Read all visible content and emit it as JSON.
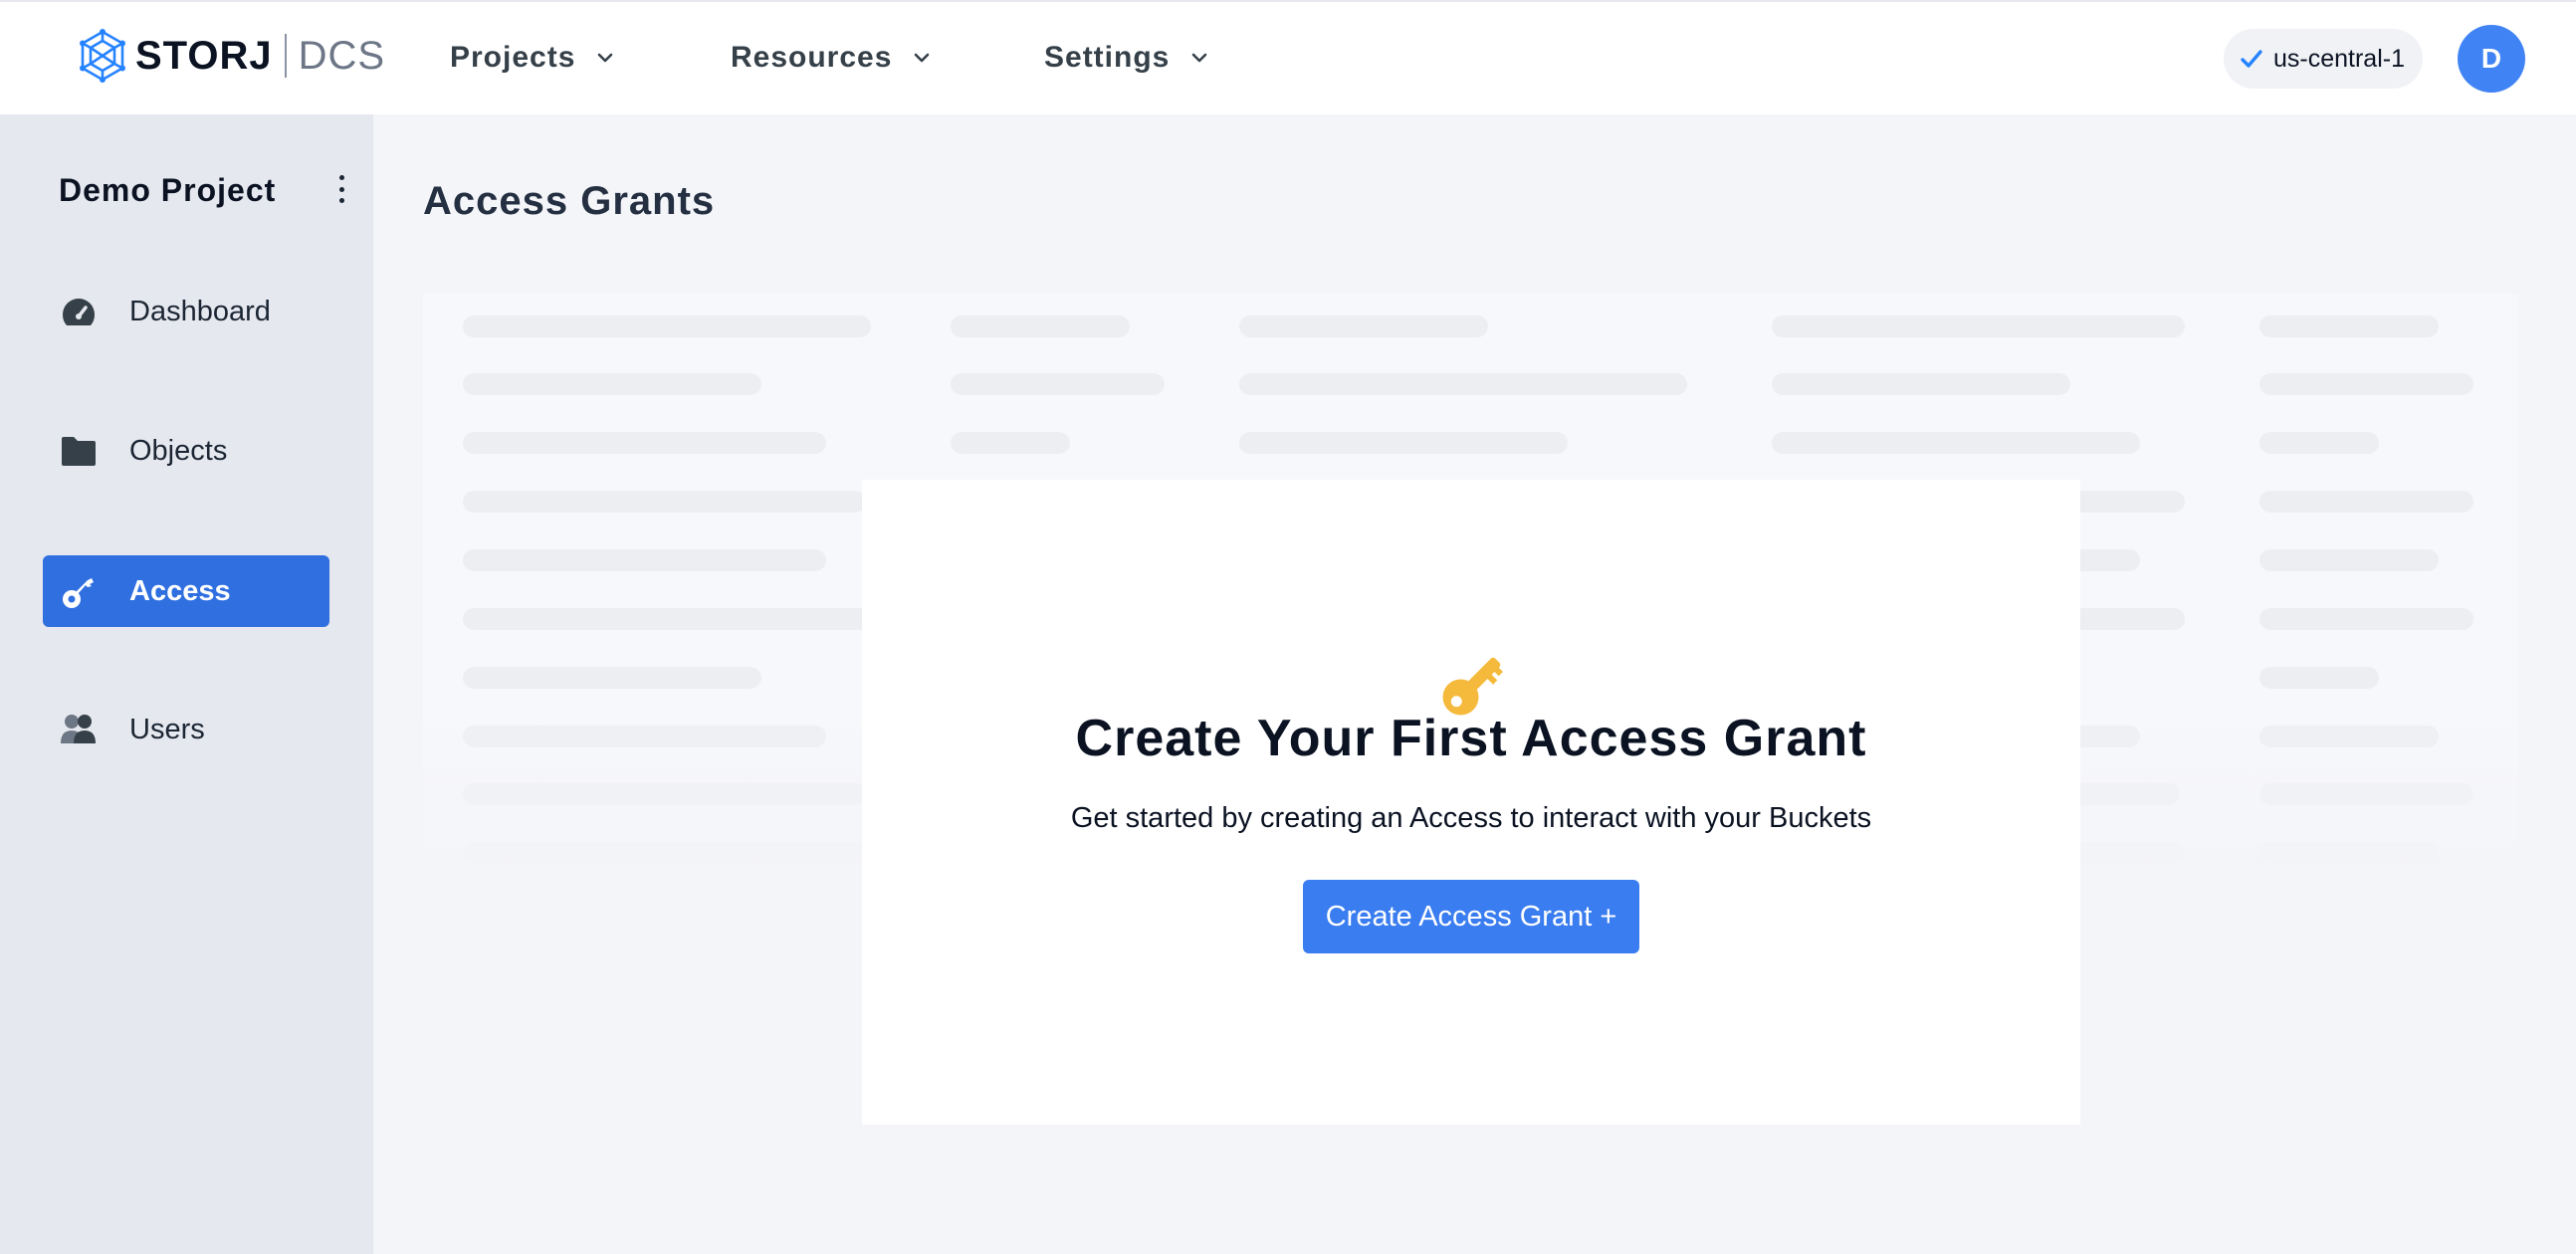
{
  "header": {
    "logo": {
      "word": "STORJ",
      "product": "DCS",
      "icon": "storj-logo-icon"
    },
    "nav": [
      {
        "label": "Projects",
        "icon": "chevron-down-icon"
      },
      {
        "label": "Resources",
        "icon": "chevron-down-icon"
      },
      {
        "label": "Settings",
        "icon": "chevron-down-icon"
      }
    ],
    "region": {
      "label": "us-central-1",
      "icon": "check-icon"
    },
    "avatar": {
      "initial": "D",
      "color": "#3f83f4"
    }
  },
  "sidebar": {
    "project_name": "Demo Project",
    "items": [
      {
        "label": "Dashboard",
        "icon": "gauge-icon",
        "active": false
      },
      {
        "label": "Objects",
        "icon": "folder-icon",
        "active": false
      },
      {
        "label": "Access",
        "icon": "key-icon",
        "active": true
      },
      {
        "label": "Users",
        "icon": "users-icon",
        "active": false
      }
    ]
  },
  "main": {
    "title": "Access Grants",
    "empty_state": {
      "icon": "golden-key-icon",
      "title": "Create Your First Access Grant",
      "subtitle": "Get started by creating an Access to interact with your Buckets",
      "button_label": "Create Access Grant +"
    }
  },
  "colors": {
    "accent": "#3a7df0",
    "sidebar_active": "#2f6fe0",
    "sidebar_bg": "#e6e8ef",
    "page_bg": "#f4f5f9",
    "key_gold": "#f5b93b"
  }
}
